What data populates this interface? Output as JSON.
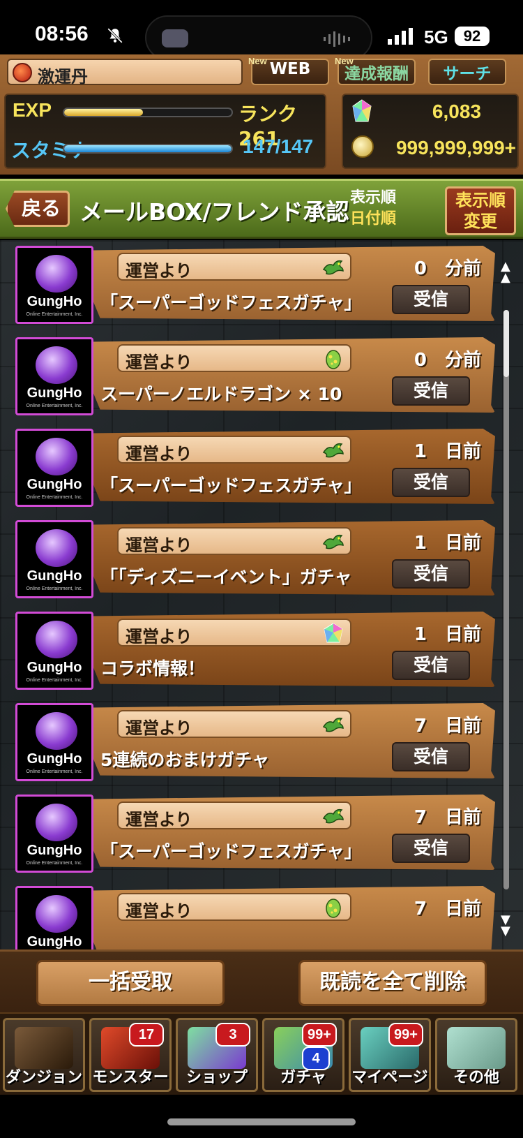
{
  "status_bar": {
    "time": "08:56",
    "network": "5G",
    "battery": "92"
  },
  "header": {
    "item_name": "激運丹",
    "web_button": "WEB",
    "achievement_button": "達成報酬",
    "search_button": "サーチ",
    "new_tag": "New",
    "exp_label": "EXP",
    "rank": "ランク 261",
    "exp_progress": 0.47,
    "stamina_label": "スタミナ",
    "stamina_value": "147/147",
    "stamina_progress": 1.0,
    "magic_stones": "6,083",
    "coins": "999,999,999+"
  },
  "title_bar": {
    "back_label": "戻る",
    "title": "メールBOX/フレンド承認",
    "sort_label": "表示順",
    "sort_value": "日付順",
    "sort_button_line1": "表示順",
    "sort_button_line2": "変更"
  },
  "messages": [
    {
      "logo_brand": "GungHo",
      "logo_sub": "Online Entertainment, Inc.",
      "sender": "運営より",
      "icon": "dragon-icon",
      "time": "0　分前",
      "subject": "「スーパーゴッドフェスガチャ」",
      "receive": "受信",
      "dark": false
    },
    {
      "logo_brand": "GungHo",
      "logo_sub": "Online Entertainment, Inc.",
      "sender": "運営より",
      "icon": "egg-icon",
      "time": "0　分前",
      "subject": "スーパーノエルドラゴン × 10",
      "receive": "受信",
      "dark": false
    },
    {
      "logo_brand": "GungHo",
      "logo_sub": "Online Entertainment, Inc.",
      "sender": "運営より",
      "icon": "dragon-icon",
      "time": "1　日前",
      "subject": "「スーパーゴッドフェスガチャ」",
      "receive": "受信",
      "dark": true
    },
    {
      "logo_brand": "GungHo",
      "logo_sub": "Online Entertainment, Inc.",
      "sender": "運営より",
      "icon": "dragon-icon",
      "time": "1　日前",
      "subject": "「「ディズニーイベント」ガチャ",
      "receive": "受信",
      "dark": true
    },
    {
      "logo_brand": "GungHo",
      "logo_sub": "Online Entertainment, Inc.",
      "sender": "運営より",
      "icon": "magic-stone-icon",
      "time": "1　日前",
      "subject": "コラボ情報！",
      "receive": "受信",
      "dark": true
    },
    {
      "logo_brand": "GungHo",
      "logo_sub": "Online Entertainment, Inc.",
      "sender": "運営より",
      "icon": "dragon-icon",
      "time": "7　日前",
      "subject": "5連続のおまけガチャ",
      "receive": "受信",
      "dark": false
    },
    {
      "logo_brand": "GungHo",
      "logo_sub": "Online Entertainment, Inc.",
      "sender": "運営より",
      "icon": "dragon-icon",
      "time": "7　日前",
      "subject": "「スーパーゴッドフェスガチャ」",
      "receive": "受信",
      "dark": false
    },
    {
      "logo_brand": "GungHo",
      "logo_sub": "Online Entertainment, Inc.",
      "sender": "運営より",
      "icon": "egg-icon",
      "time": "7　日前",
      "subject": "",
      "receive": "",
      "dark": false
    }
  ],
  "actions": {
    "receive_all": "一括受取",
    "delete_read": "既読を全て削除"
  },
  "nav": [
    {
      "label": "ダンジョン",
      "badge": null,
      "badge2": null,
      "colors": [
        "#7a5a3a",
        "#2a1a0a"
      ]
    },
    {
      "label": "モンスター",
      "badge": "17",
      "badge2": null,
      "colors": [
        "#e04a2a",
        "#6a1008"
      ]
    },
    {
      "label": "ショップ",
      "badge": "3",
      "badge2": null,
      "colors": [
        "#7ee0a0",
        "#7a3ad0"
      ]
    },
    {
      "label": "ガチャ",
      "badge": "99+",
      "badge2": "4",
      "colors": [
        "#8ad05a",
        "#3a8ab0"
      ]
    },
    {
      "label": "マイページ",
      "badge": "99+",
      "badge2": null,
      "colors": [
        "#6ad0c0",
        "#2a6a6a"
      ]
    },
    {
      "label": "その他",
      "badge": null,
      "badge2": null,
      "colors": [
        "#b0e0d0",
        "#6a9a8a"
      ]
    }
  ]
}
